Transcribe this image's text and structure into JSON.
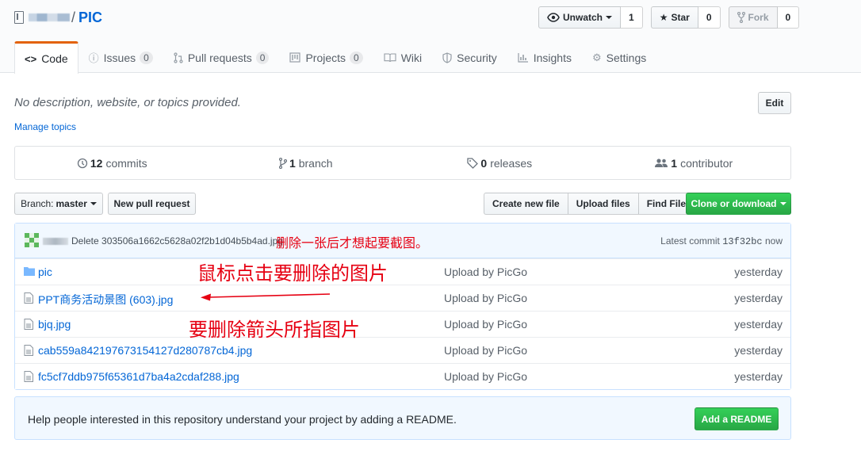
{
  "header": {
    "repo_name": "PIC",
    "separator": "/",
    "watch": {
      "label": "Unwatch",
      "count": "1"
    },
    "star": {
      "label": "Star",
      "count": "0"
    },
    "fork": {
      "label": "Fork",
      "count": "0"
    }
  },
  "nav": {
    "tabs": [
      {
        "label": "Code",
        "icon": "code-icon"
      },
      {
        "label": "Issues",
        "counter": "0",
        "icon": "issue-icon"
      },
      {
        "label": "Pull requests",
        "counter": "0",
        "icon": "pull-request-icon"
      },
      {
        "label": "Projects",
        "counter": "0",
        "icon": "project-icon"
      },
      {
        "label": "Wiki",
        "icon": "book-icon"
      },
      {
        "label": "Security",
        "icon": "shield-icon"
      },
      {
        "label": "Insights",
        "icon": "graph-icon"
      },
      {
        "label": "Settings",
        "icon": "gear-icon"
      }
    ]
  },
  "about": {
    "description": "No description, website, or topics provided.",
    "edit_label": "Edit",
    "manage_topics": "Manage topics"
  },
  "summary": {
    "commits": {
      "count": "12",
      "label": "commits"
    },
    "branches": {
      "count": "1",
      "label": "branch"
    },
    "releases": {
      "count": "0",
      "label": "releases"
    },
    "contributors": {
      "count": "1",
      "label": "contributor"
    }
  },
  "filebar": {
    "branch_prefix": "Branch:",
    "branch_name": "master",
    "new_pr": "New pull request",
    "create_file": "Create new file",
    "upload_files": "Upload files",
    "find_file": "Find File",
    "clone": "Clone or download"
  },
  "commit": {
    "message": "Delete 303506a1662c5628a02f2b1d04b5b4ad.jpg",
    "annotation": "删除一张后才想起要截图。",
    "latest_label": "Latest commit",
    "sha": "13f32bc",
    "age": "now"
  },
  "files": [
    {
      "name": "pic",
      "type": "folder",
      "message": "Upload by PicGo",
      "age": "yesterday"
    },
    {
      "name": "PPT商务活动景图 (603).jpg",
      "type": "file",
      "message": "Upload by PicGo",
      "age": "yesterday"
    },
    {
      "name": "bjq.jpg",
      "type": "file",
      "message": "Upload by PicGo",
      "age": "yesterday"
    },
    {
      "name": "cab559a842197673154127d280787cb4.jpg",
      "type": "file",
      "message": "Upload by PicGo",
      "age": "yesterday"
    },
    {
      "name": "fc5cf7ddb975f65361d7ba4a2cdaf288.jpg",
      "type": "file",
      "message": "Upload by PicGo",
      "age": "yesterday"
    }
  ],
  "annotations": {
    "click_note": "鼠标点击要删除的图片",
    "arrow_note": "要删除箭头所指图片"
  },
  "readme": {
    "text": "Help people interested in this repository understand your project by adding a README.",
    "button": "Add a README"
  },
  "colors": {
    "accent": "#0366d6",
    "green": "#28a745",
    "tab_highlight": "#e36209",
    "annotation_red": "#e60012"
  }
}
